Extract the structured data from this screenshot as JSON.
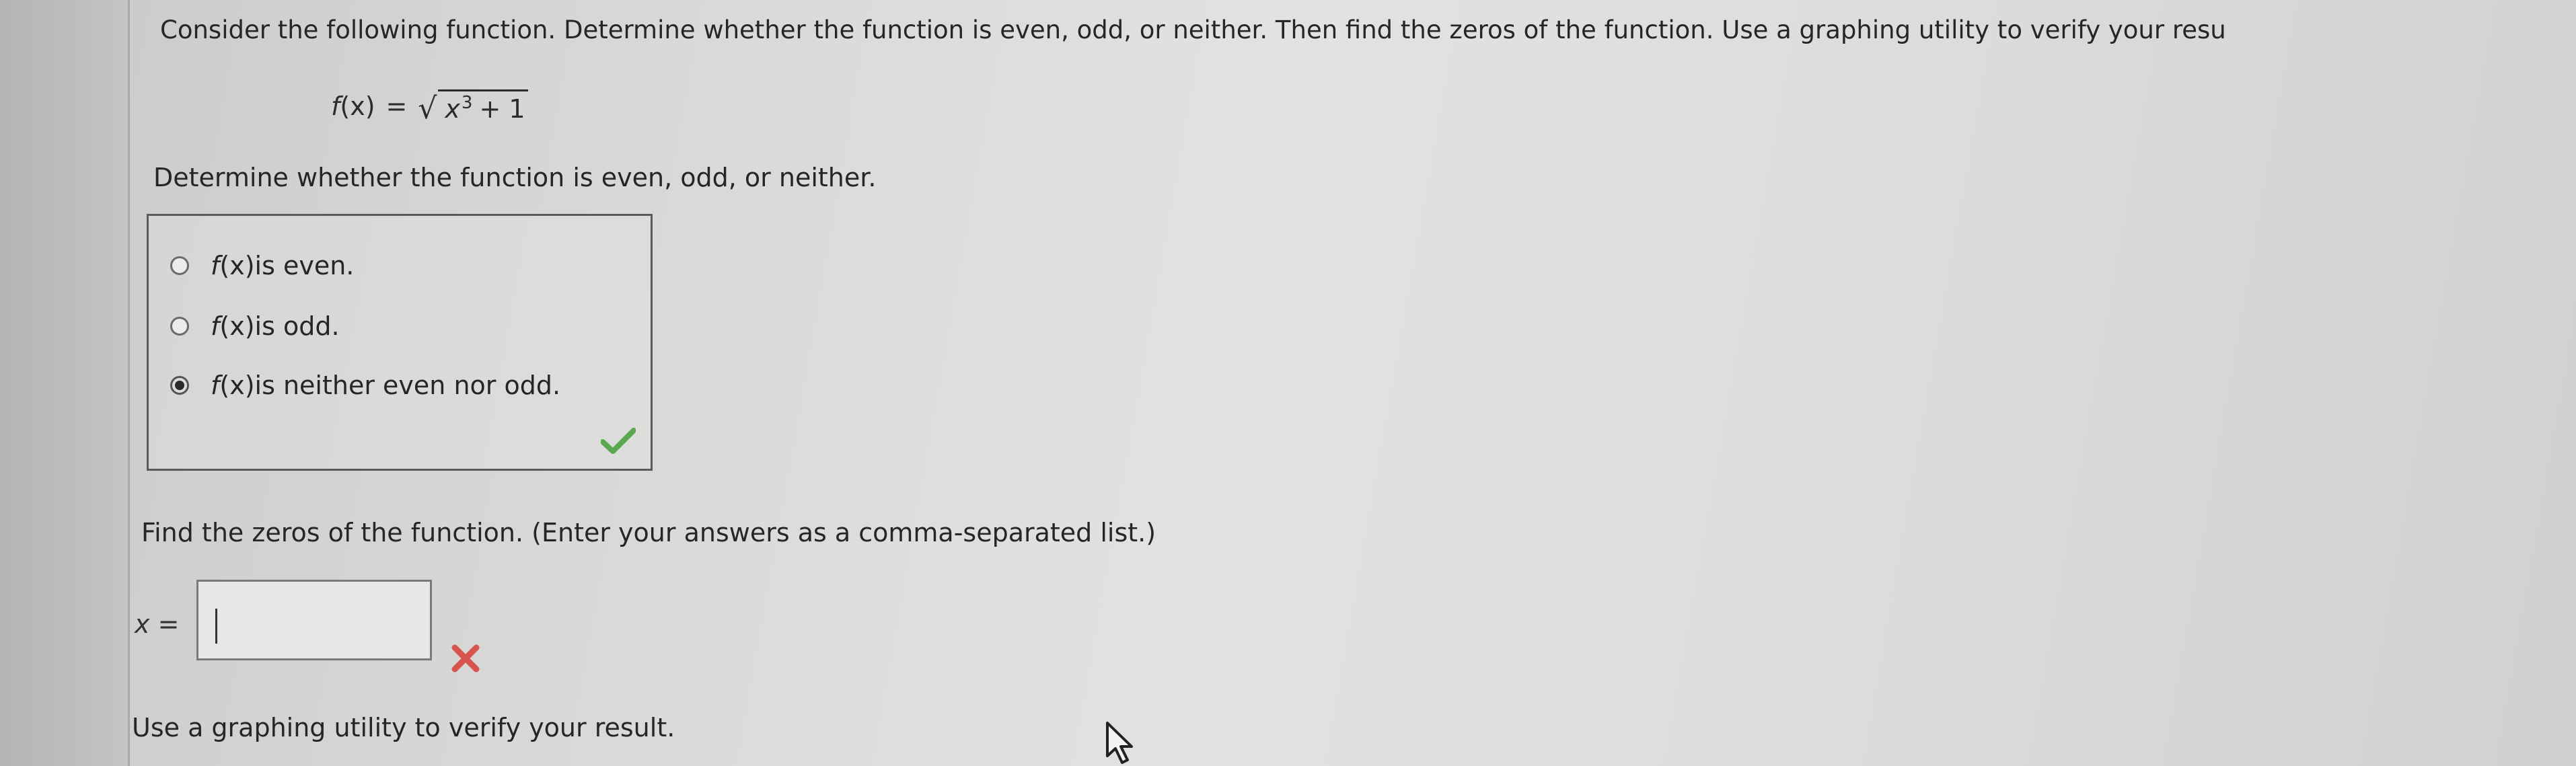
{
  "question": {
    "prompt": "Consider the following function. Determine whether the function is even, odd, or neither. Then find the zeros of the function. Use a graphing utility to verify your resu",
    "formula": {
      "lhs_func": "f",
      "lhs_arg": "(x)",
      "equals": "=",
      "radicand_var": "x",
      "radicand_exp": "3",
      "radicand_rest": "+ 1"
    }
  },
  "part1": {
    "label": "Determine whether the function is even, odd, or neither.",
    "options": [
      {
        "func": "f",
        "arg": "(x)",
        "text": " is even.",
        "selected": false
      },
      {
        "func": "f",
        "arg": "(x)",
        "text": " is odd.",
        "selected": false
      },
      {
        "func": "f",
        "arg": "(x)",
        "text": " is neither even nor odd.",
        "selected": true
      }
    ],
    "status": "correct",
    "status_icon": "checkmark-icon",
    "status_color": "#5aa84f"
  },
  "part2": {
    "label": "Find the zeros of the function. (Enter your answers as a comma-separated list.)",
    "input_var": "x",
    "input_eq": "=",
    "input_value": "",
    "status": "incorrect",
    "status_icon": "x-mark-icon",
    "status_color": "#d9534f"
  },
  "part3": {
    "label": "Use a graphing utility to verify your result."
  },
  "cursor_icon": "mouse-pointer-icon"
}
